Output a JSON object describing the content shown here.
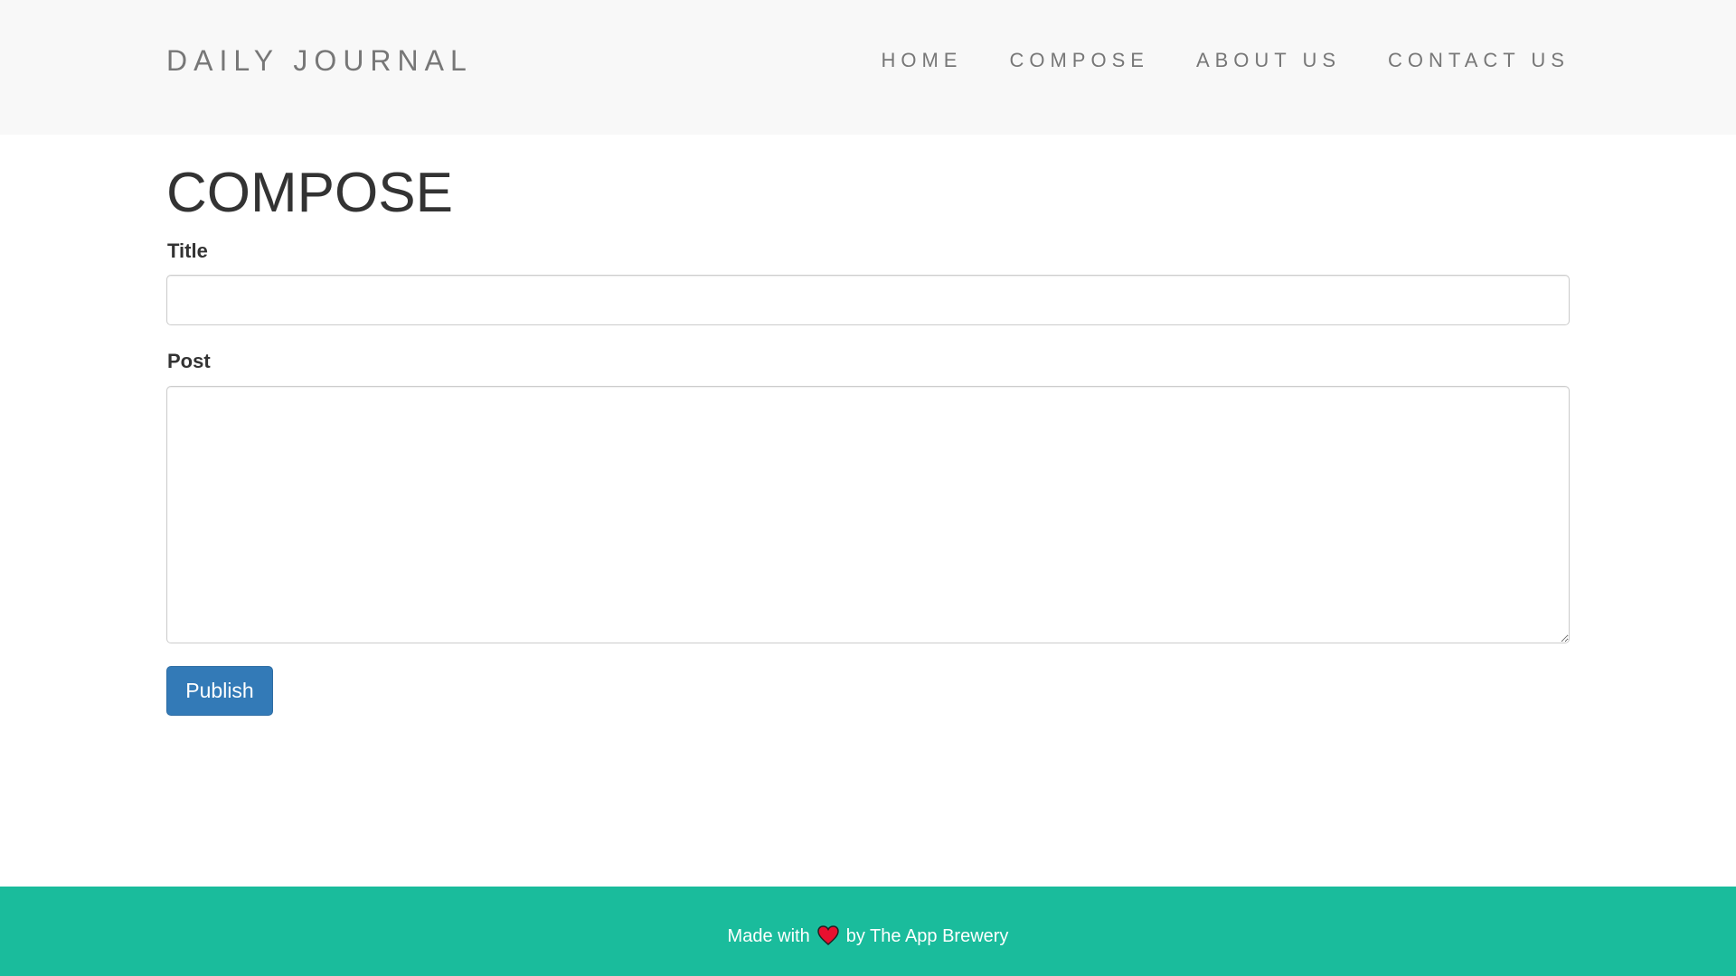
{
  "header": {
    "brand": "DAILY JOURNAL",
    "nav": [
      {
        "label": "HOME"
      },
      {
        "label": "COMPOSE"
      },
      {
        "label": "ABOUT US"
      },
      {
        "label": "CONTACT US"
      }
    ]
  },
  "main": {
    "title": "COMPOSE",
    "title_field": {
      "label": "Title",
      "value": "",
      "placeholder": ""
    },
    "post_field": {
      "label": "Post",
      "value": "",
      "placeholder": ""
    },
    "publish_label": "Publish"
  },
  "footer": {
    "text_before": "Made with",
    "icon": "heart-icon",
    "text_after": "by The App Brewery"
  },
  "colors": {
    "navbar_bg": "#f8f8f8",
    "accent": "#337ab7",
    "footer_bg": "#1abc9c",
    "heart": "#e8102f"
  }
}
